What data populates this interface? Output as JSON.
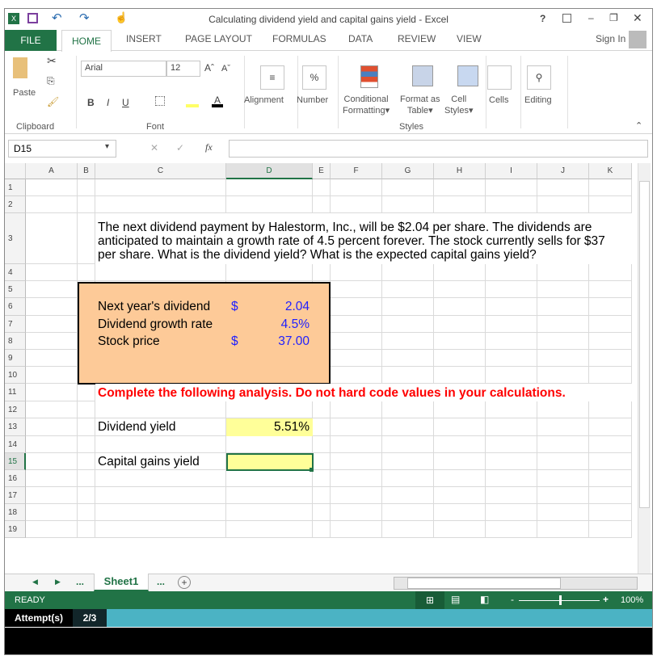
{
  "window": {
    "title": "Calculating dividend yield and capital gains yield - Excel",
    "help": "?",
    "minimize": "–",
    "restore": "❐",
    "close": "✕"
  },
  "tabs": {
    "file": "FILE",
    "items": [
      "HOME",
      "INSERT",
      "PAGE LAYOUT",
      "FORMULAS",
      "DATA",
      "REVIEW",
      "VIEW"
    ],
    "sign_in": "Sign In"
  },
  "ribbon": {
    "paste": "Paste",
    "clipboard": "Clipboard",
    "font_name": "Arial",
    "font_size": "12",
    "font": "Font",
    "bold": "B",
    "italic": "I",
    "underline": "U",
    "alignment": "Alignment",
    "number": "Number",
    "percent": "%",
    "conditional": "Conditional",
    "formatting": "Formatting",
    "format_as": "Format as",
    "table": "Table",
    "cell": "Cell",
    "styles_btn": "Styles",
    "styles": "Styles",
    "cells": "Cells",
    "editing": "Editing"
  },
  "formula_bar": {
    "name_box": "D15",
    "fx": "fx",
    "value": ""
  },
  "columns": [
    "A",
    "B",
    "C",
    "D",
    "E",
    "F",
    "G",
    "H",
    "I",
    "J",
    "K"
  ],
  "rows": [
    "1",
    "2",
    "3",
    "4",
    "5",
    "6",
    "7",
    "8",
    "9",
    "10",
    "11",
    "12",
    "13",
    "14",
    "15",
    "16",
    "17",
    "18",
    "19"
  ],
  "sheet": {
    "question": [
      "The next dividend payment by Halestorm, Inc., will be $2.04 per share. The dividends are",
      "anticipated to maintain a growth rate of 4.5 percent forever. The stock currently sells for $37",
      "per share. What is the dividend yield? What is the expected capital gains yield?"
    ],
    "inputs": [
      {
        "label": "Next year's dividend",
        "cur": "$",
        "value": "2.04"
      },
      {
        "label": "Dividend growth rate",
        "cur": "",
        "value": "4.5%"
      },
      {
        "label": "Stock price",
        "cur": "$",
        "value": "37.00"
      }
    ],
    "instruction": "Complete the following analysis. Do not hard code values in your calculations.",
    "dividend_yield_label": "Dividend yield",
    "dividend_yield_value": "5.51%",
    "capital_gains_label": "Capital gains yield",
    "capital_gains_value": ""
  },
  "sheet_tabs": {
    "active": "Sheet1",
    "more": "...",
    "add": "+"
  },
  "status": {
    "ready": "READY",
    "zoom": "100%"
  },
  "attempts": {
    "label": "Attempt(s)",
    "value": "2/3"
  },
  "colors": {
    "excel_green": "#217346",
    "input_box": "#fdca98",
    "answer_fill": "#ffff99",
    "instruction_red": "#ff0000",
    "input_blue": "#1f1fff",
    "attempt_bar": "#4bb3c4"
  }
}
